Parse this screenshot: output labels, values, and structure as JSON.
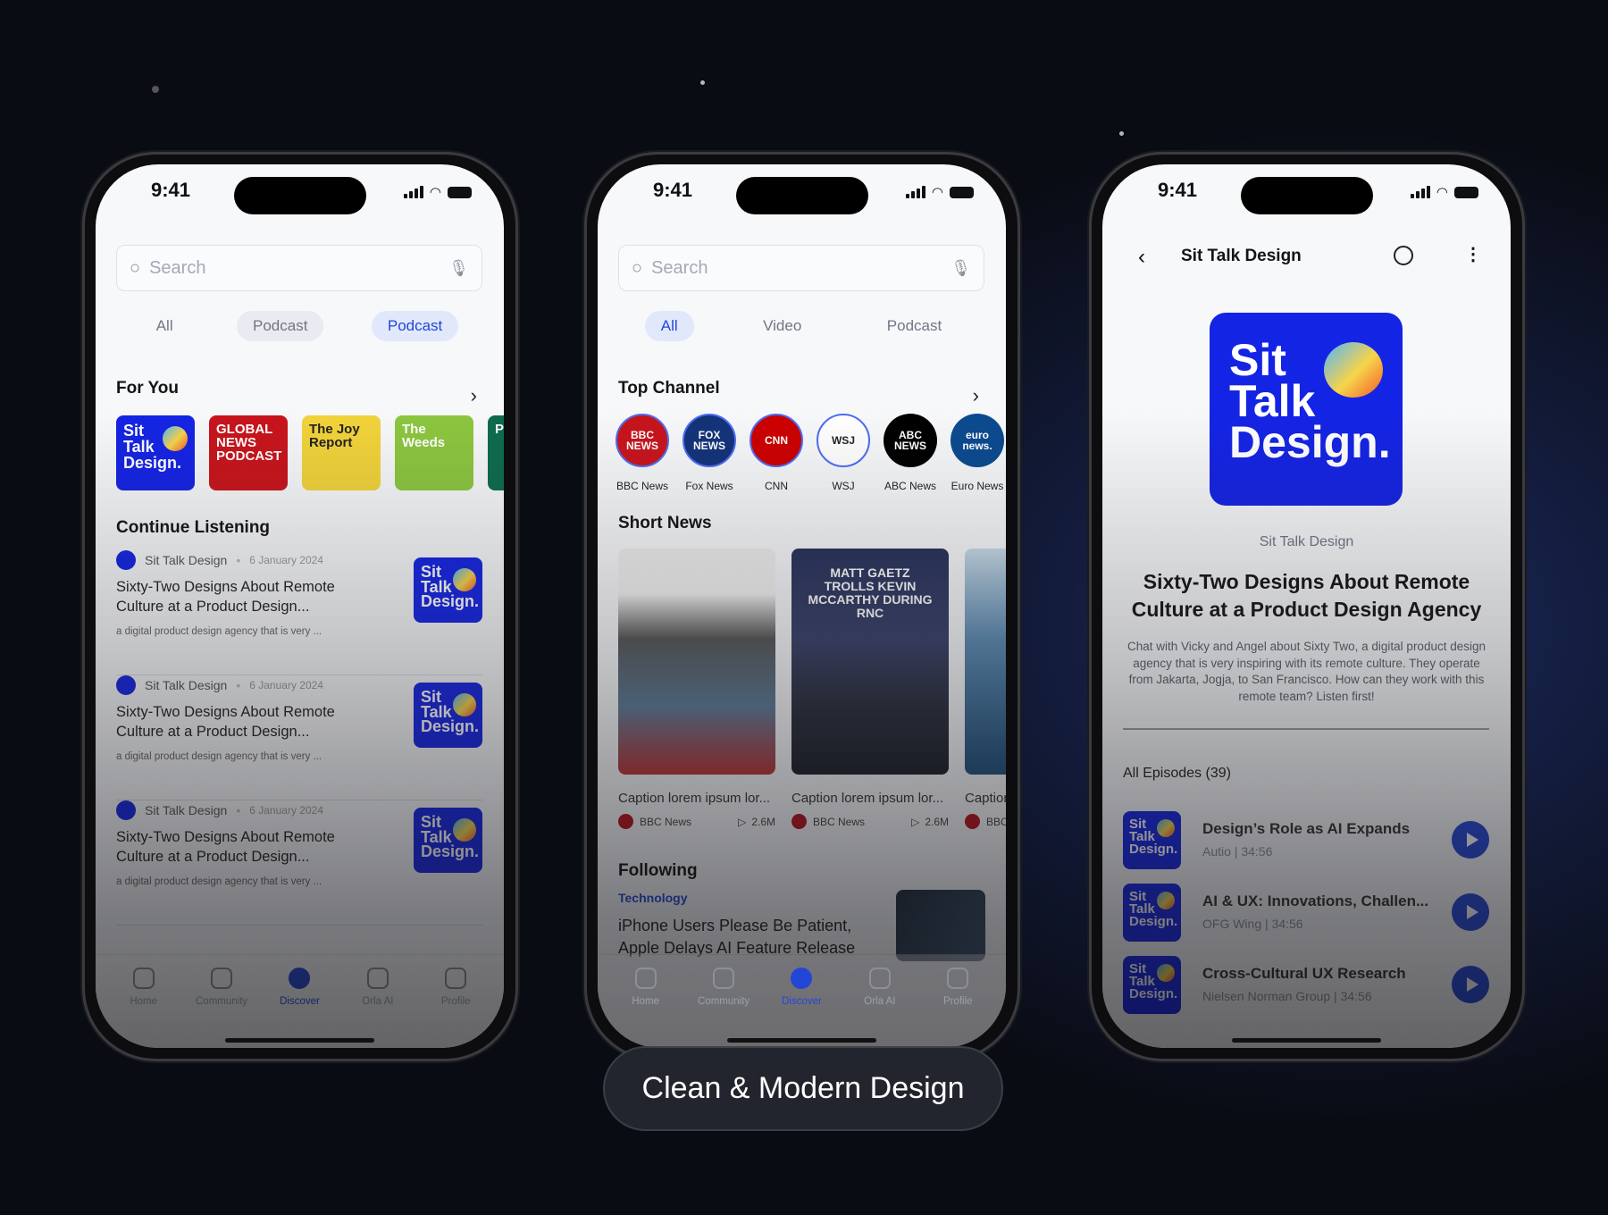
{
  "status": {
    "time": "9:41"
  },
  "phone1": {
    "search_placeholder": "Search",
    "tabs": [
      "All",
      "Podcast",
      "Podcast"
    ],
    "for_you": "For You",
    "podcasts": [
      {
        "name": "Sit Talk Design.",
        "color": "#1424e4"
      },
      {
        "name": "GLOBAL NEWS PODCAST",
        "color": "#c8141c"
      },
      {
        "name": "The Joy Report",
        "color": "#f2d33a"
      },
      {
        "name": "The Weeds",
        "color": "#8cc63f"
      },
      {
        "name": "Pl",
        "color": "#0e6b4e"
      }
    ],
    "continue_listening": "Continue Listening",
    "items": [
      {
        "source": "Sit Talk Design",
        "date": "6 January 2024",
        "title": "Sixty-Two Designs About Remote Culture at a Product Design...",
        "desc": "a digital product design agency that is very ..."
      },
      {
        "source": "Sit Talk Design",
        "date": "6 January 2024",
        "title": "Sixty-Two Designs About Remote Culture at a Product Design...",
        "desc": "a digital product design agency that is very ..."
      },
      {
        "source": "Sit Talk Design",
        "date": "6 January 2024",
        "title": "Sixty-Two Designs About Remote Culture at a Product Design...",
        "desc": "a digital product design agency that is very ..."
      }
    ]
  },
  "phone2": {
    "search_placeholder": "Search",
    "tabs": [
      "All",
      "Video",
      "Podcast"
    ],
    "top_channel": "Top Channel",
    "channels": [
      {
        "name": "BBC News",
        "logo": "BBC NEWS",
        "color": "#c8141c"
      },
      {
        "name": "Fox News",
        "logo": "FOX NEWS",
        "color": "#13337a"
      },
      {
        "name": "CNN",
        "logo": "CNN",
        "color": "#cc0000"
      },
      {
        "name": "WSJ",
        "logo": "WSJ",
        "color": "#ffffff"
      },
      {
        "name": "ABC News",
        "logo": "ABC NEWS",
        "color": "#000000"
      },
      {
        "name": "Euro News",
        "logo": "euro news.",
        "color": "#0b4a8f"
      }
    ],
    "short_news": "Short News",
    "news": [
      {
        "caption": "Caption lorem ipsum lor...",
        "source": "BBC News",
        "views": "2.6M",
        "overlay": ""
      },
      {
        "caption": "Caption lorem ipsum lor...",
        "source": "BBC News",
        "views": "2.6M",
        "overlay": "MATT GAETZ TROLLS KEVIN MCCARTHY DURING RNC"
      },
      {
        "caption": "Caption lorem ipsum lor...",
        "source": "BBC News",
        "views": "",
        "overlay": ""
      }
    ],
    "following": "Following",
    "following_category": "Technology",
    "following_headline": "iPhone Users Please Be Patient, Apple Delays AI Feature Release"
  },
  "nav": [
    "Home",
    "Community",
    "Discover",
    "Orla AI",
    "Profile"
  ],
  "phone3": {
    "header_title": "Sit Talk Design",
    "cover_text": "Sit Talk Design.",
    "publisher": "Sit Talk Design",
    "title": "Sixty-Two Designs About Remote Culture at a Product Design Agency",
    "description": "Chat with Vicky and Angel about Sixty Two, a digital product design agency that is very inspiring with its remote culture. They operate from Jakarta, Jogja, to San Francisco. How can they work with this remote team? Listen first!",
    "episodes_label": "All Episodes (39)",
    "episodes": [
      {
        "title": "Design’s Role as AI Expands",
        "sub": "Autio | 34:56"
      },
      {
        "title": "AI & UX: Innovations, Challen...",
        "sub": "OFG Wing | 34:56"
      },
      {
        "title": "Cross-Cultural UX Research",
        "sub": "Nielsen Norman Group | 34:56"
      }
    ]
  },
  "caption": "Clean & Modern Design",
  "colors": {
    "accent": "#2346d6",
    "brand_blue": "#1424e4",
    "background": "#0a0c14"
  }
}
